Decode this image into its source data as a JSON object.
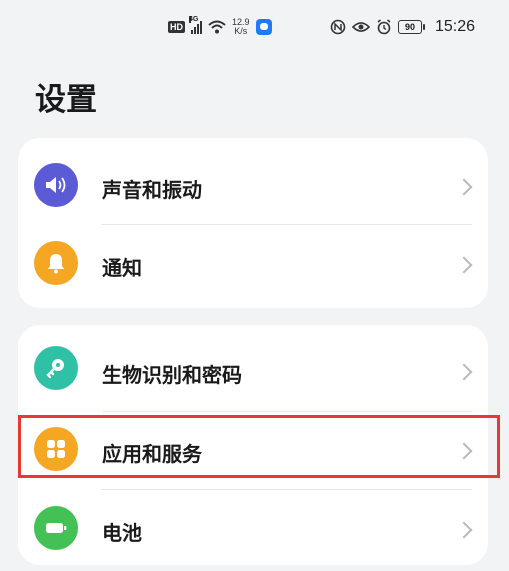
{
  "status_bar": {
    "network_type": "4G",
    "hd_label": "HD",
    "speed_value": "12.9",
    "speed_unit": "K/s",
    "battery_level": "90",
    "time": "15:26"
  },
  "page": {
    "title": "设置"
  },
  "groups": [
    {
      "items": [
        {
          "label": "声音和振动",
          "icon": "speaker-icon",
          "color": "#5b5bd6"
        },
        {
          "label": "通知",
          "icon": "bell-icon",
          "color": "#f5a623"
        }
      ]
    },
    {
      "items": [
        {
          "label": "生物识别和密码",
          "icon": "key-icon",
          "color": "#2fc1a5"
        },
        {
          "label": "应用和服务",
          "icon": "apps-icon",
          "color": "#f5a623",
          "highlighted": true
        },
        {
          "label": "电池",
          "icon": "battery-icon",
          "color": "#43c154"
        }
      ]
    }
  ]
}
